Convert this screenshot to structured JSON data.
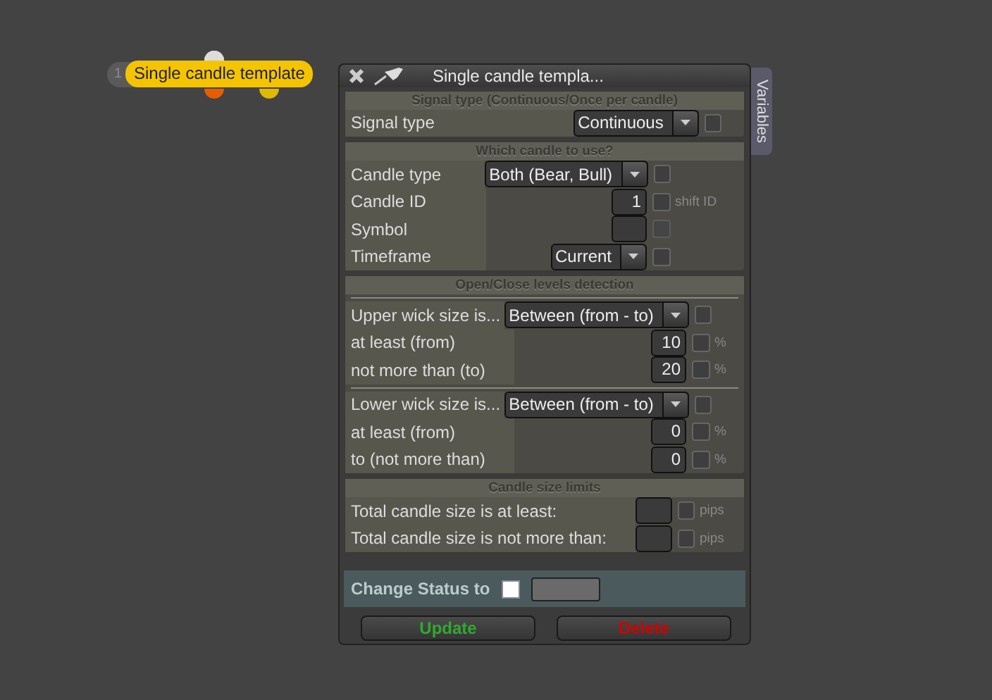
{
  "node": {
    "number": "1",
    "label": "Single candle template"
  },
  "panel": {
    "title": "Single candle templa...",
    "side_tab": "Variables",
    "sections": [
      {
        "heading": "Signal type (Continuous/Once per candle)",
        "groups": [
          [
            {
              "kind": "select",
              "label": "Signal type",
              "value": "Continuous",
              "checked": false
            }
          ]
        ]
      },
      {
        "heading": "Which candle to use?",
        "groups": [
          [
            {
              "kind": "select",
              "label": "Candle type",
              "value": "Both (Bear, Bull)",
              "checked": false
            },
            {
              "kind": "number",
              "label": "Candle ID",
              "value": "1",
              "checked": false,
              "unit": "shift ID"
            },
            {
              "kind": "number",
              "label": "Symbol",
              "checked": false,
              "disabled": true
            },
            {
              "kind": "select",
              "label": "Timeframe",
              "value": "Current",
              "checked": false
            }
          ]
        ]
      },
      {
        "heading": "Open/Close levels detection",
        "groups": [
          [
            {
              "kind": "select",
              "label": "Upper wick size is...",
              "value": "Between (from - to)",
              "checked": false
            },
            {
              "kind": "number",
              "label": "at least (from)",
              "value": "10",
              "checked": false,
              "unit": "%"
            },
            {
              "kind": "number",
              "label": "not more than (to)",
              "value": "20",
              "checked": false,
              "unit": "%"
            }
          ],
          [
            {
              "kind": "select",
              "label": "Lower wick size is...",
              "value": "Between (from - to)",
              "checked": false
            },
            {
              "kind": "number",
              "label": "at least (from)",
              "value": "0",
              "checked": false,
              "unit": "%"
            },
            {
              "kind": "number",
              "label": "to (not more than)",
              "value": "0",
              "checked": false,
              "unit": "%"
            }
          ]
        ]
      },
      {
        "heading": "Candle size limits",
        "groups": [
          [
            {
              "kind": "number",
              "label": "Total candle size is at least:",
              "checked": false,
              "unit": "pips"
            },
            {
              "kind": "number",
              "label": "Total candle size is not more than:",
              "checked": false,
              "unit": "pips"
            }
          ]
        ]
      }
    ],
    "status": {
      "label": "Change Status to",
      "checked": false
    },
    "buttons": [
      {
        "label": "Update",
        "color": "#2faa2f"
      },
      {
        "label": "Delete",
        "color": "#d40000"
      }
    ]
  }
}
